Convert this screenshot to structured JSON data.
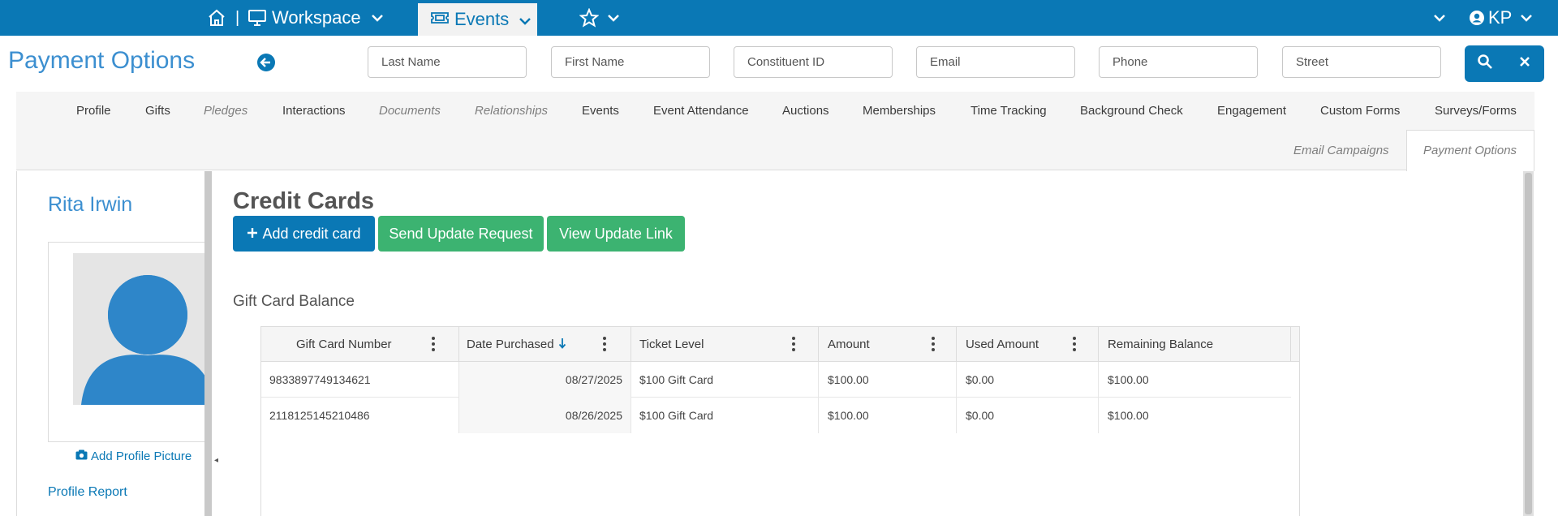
{
  "topbar": {
    "workspace_label": "Workspace",
    "separator": "|",
    "events_label": "Events",
    "user_initials": "KP"
  },
  "header": {
    "title": "Payment Options",
    "search_fields": [
      {
        "placeholder": "Last Name"
      },
      {
        "placeholder": "First Name"
      },
      {
        "placeholder": "Constituent ID"
      },
      {
        "placeholder": "Email"
      },
      {
        "placeholder": "Phone"
      },
      {
        "placeholder": "Street"
      }
    ]
  },
  "tabs": {
    "row1": [
      {
        "label": "Profile"
      },
      {
        "label": "Gifts"
      },
      {
        "label": "Pledges"
      },
      {
        "label": "Interactions"
      },
      {
        "label": "Documents"
      },
      {
        "label": "Relationships"
      },
      {
        "label": "Events"
      },
      {
        "label": "Event Attendance"
      },
      {
        "label": "Auctions"
      },
      {
        "label": "Memberships"
      },
      {
        "label": "Time Tracking"
      },
      {
        "label": "Background Check"
      },
      {
        "label": "Engagement"
      },
      {
        "label": "Custom Forms"
      },
      {
        "label": "Surveys/Forms"
      }
    ],
    "row2": [
      {
        "label": "Email Campaigns"
      },
      {
        "label": "Payment Options"
      }
    ]
  },
  "profile": {
    "name": "Rita Irwin",
    "add_picture_label": "Add Profile Picture",
    "report_label": "Profile Report"
  },
  "main": {
    "title": "Credit Cards",
    "add_button": "Add credit card",
    "send_button": "Send Update Request",
    "view_button": "View Update Link",
    "section_label": "Gift Card Balance"
  },
  "grid": {
    "columns": [
      "Gift Card Number",
      "Date Purchased",
      "Ticket Level",
      "Amount",
      "Used Amount",
      "Remaining Balance"
    ],
    "rows": [
      [
        "9833897749134621",
        "08/27/2025",
        "$100 Gift Card",
        "$100.00",
        "$0.00",
        "$100.00"
      ],
      [
        "2118125145210486",
        "08/26/2025",
        "$100 Gift Card",
        "$100.00",
        "$0.00",
        "$100.00"
      ]
    ]
  },
  "colors": {
    "brand": "#0a78b5",
    "accent_green": "#3cb371",
    "title_blue": "#3c8fd0"
  }
}
